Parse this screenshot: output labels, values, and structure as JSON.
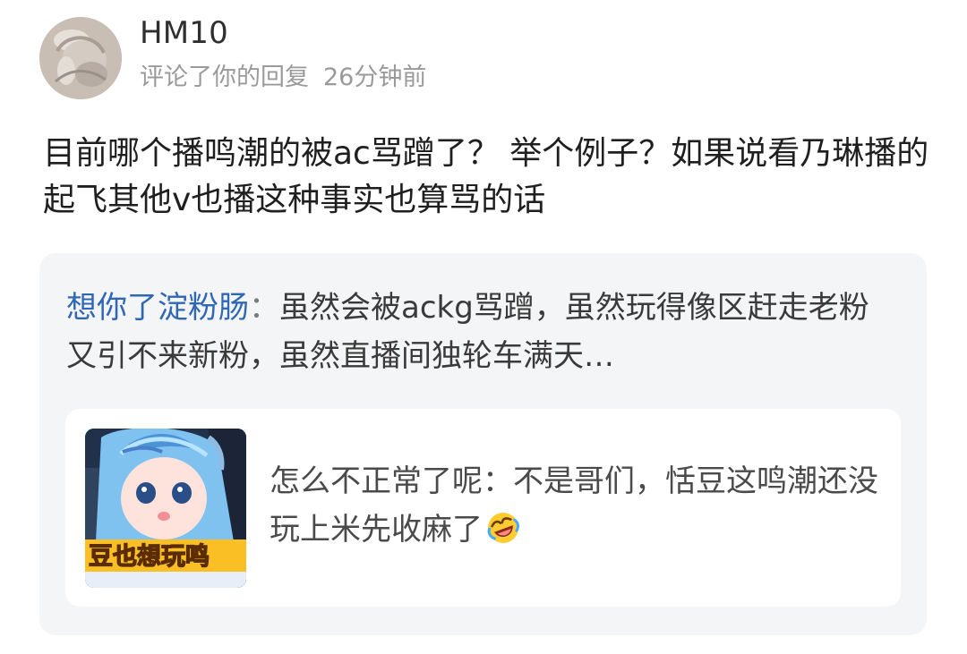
{
  "header": {
    "username": "HM10",
    "action": "评论了你的回复",
    "time": "26分钟前"
  },
  "comment": {
    "text": "目前哪个播鸣潮的被ac骂蹭了？ 举个例子？如果说看乃琳播的起飞其他v也播这种事实也算骂的话"
  },
  "quoted_reply": {
    "author": "想你了淀粉肠",
    "separator": "：",
    "text": "虽然会被ackg骂蹭，虽然玩得像区赶走老粉又引不来新粉，虽然直播间独轮车满天…"
  },
  "referenced_post": {
    "thumbnail_caption": "豆也想玩鸣",
    "author": "怎么不正常了呢",
    "separator": "：",
    "text": "不是哥们，恬豆这鸣潮还没玩上米先收麻了",
    "emoji": "rolling-on-floor-laughing-icon"
  },
  "colors": {
    "username": "#2f2f2f",
    "meta": "#9a9a9a",
    "link_author": "#2f67b6",
    "card_bg": "#f4f5f7",
    "inner_card_bg": "#ffffff"
  }
}
